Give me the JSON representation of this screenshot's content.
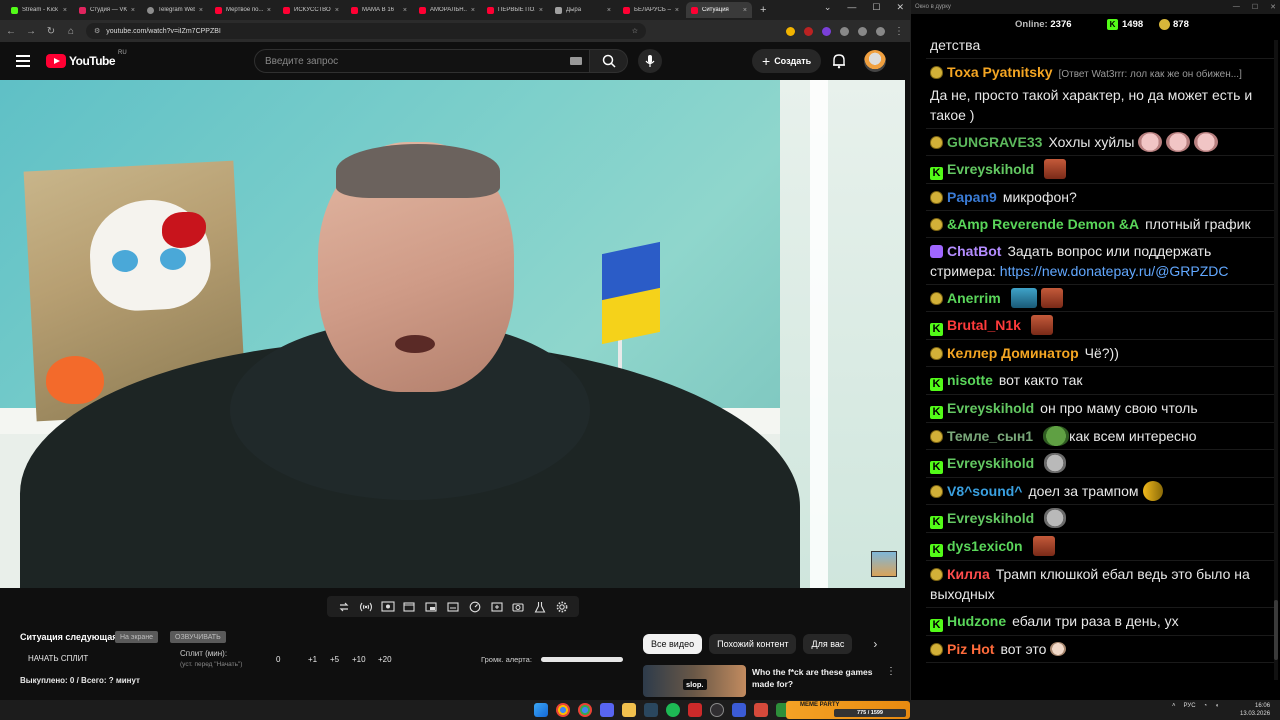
{
  "browser": {
    "tabs": [
      {
        "label": "Stream - Kick",
        "icon": "kick"
      },
      {
        "label": "Студия — VK",
        "icon": "vk"
      },
      {
        "label": "Telegram Web",
        "icon": "tg"
      },
      {
        "label": "Мертвое по...",
        "icon": "yt"
      },
      {
        "label": "ИСКУССТВО",
        "icon": "yt"
      },
      {
        "label": "МАМА В 16",
        "icon": "yt"
      },
      {
        "label": "АМОРАЛЬН...",
        "icon": "yt"
      },
      {
        "label": "ПЕРВЫЕ ПО...",
        "icon": "yt"
      },
      {
        "label": "Дыра",
        "icon": "dz"
      },
      {
        "label": "БЕЛАРУСЬ —",
        "icon": "yt"
      },
      {
        "label": "Ситуация",
        "icon": "yt",
        "active": true
      }
    ],
    "new_tab": "+",
    "window_controls": [
      "⌄",
      "—",
      "☐",
      "✕"
    ],
    "url": "youtube.com/watch?v=iIZm7CPPZBI"
  },
  "youtube": {
    "wordmark": "YouTube",
    "region": "RU",
    "search_placeholder": "Введите запрос",
    "create_label": "Создать"
  },
  "below": {
    "situation_title": "Ситуация следующая",
    "pill_onscreen": "На экране",
    "pill_voice": "ОЗВУЧИВАТЬ",
    "start_split": "НАЧАТЬ СПЛИТ",
    "split_label": "Сплит (мин):",
    "split_hint": "(уст. перед \"Начать\")",
    "split_values": [
      "0",
      "+1",
      "+5",
      "+10",
      "+20"
    ],
    "sold_out": "Выкуплено: 0 / Всего: ? минут",
    "alert_label": "Громк. алерта:",
    "alert_volume_fraction": 1.0,
    "chips": [
      "Все видео",
      "Похожий контент",
      "Для вас"
    ],
    "rec_badge": "slop.",
    "rec_title": "Who the f*ck are these games made for?"
  },
  "chat": {
    "window_title": "Окно в дурку",
    "online_label": "Online:",
    "online_count": "2376",
    "k_count": "1498",
    "pepe_count": "878",
    "messages": [
      {
        "badge": "",
        "nick": "",
        "color": "#e8e8e8",
        "text": "детства"
      },
      {
        "badge": "p",
        "nick": "Toxa Pyatnitsky",
        "color": "#f5a623",
        "reply": "[Ответ Wat3rrr: лол как же он обижен...]",
        "text": "Да не, просто такой характер, но да может есть и такое )"
      },
      {
        "badge": "p",
        "nick": "GUNGRAVE33",
        "color": "#5cb85c",
        "text": "Хохлы хуйлы",
        "emotes": [
          "brain",
          "brain",
          "brain"
        ]
      },
      {
        "badge": "k",
        "nick": "Evreyskihold",
        "color": "#63c862",
        "text": "",
        "emotes": [
          "face"
        ]
      },
      {
        "badge": "p",
        "nick": "Papan9",
        "color": "#3a7bd5",
        "text": "микрофон?"
      },
      {
        "badge": "p",
        "nick": "&Amp Reverende Demon &A",
        "color": "#5ad65a",
        "text": "плотный график"
      },
      {
        "badge": "bot",
        "nick": "ChatBot",
        "color": "#b48cff",
        "text": "Задать вопрос или поддержать стримера:",
        "link": "https://new.donatepay.ru/@GRPZDC"
      },
      {
        "badge": "p",
        "nick": "Anerrim",
        "color": "#5ad65a",
        "text": "",
        "emotes": [
          "blue",
          "face"
        ]
      },
      {
        "badge": "k",
        "nick": "Brutal_N1k",
        "color": "#ff3b3b",
        "text": "",
        "emotes": [
          "face"
        ]
      },
      {
        "badge": "p",
        "nick": "Келлер Доминатор",
        "color": "#f5a623",
        "text": "Чё?))"
      },
      {
        "badge": "k",
        "nick": "nisotte",
        "color": "#5ad65a",
        "text": "вот както так"
      },
      {
        "badge": "k",
        "nick": "Evreyskihold",
        "color": "#63c862",
        "text": "он про маму свою чтоль"
      },
      {
        "badge": "p",
        "nick": "Темле_сын1",
        "color": "#7aa87a",
        "text": "как всем интересно",
        "emotes_before": [
          "pepe"
        ]
      },
      {
        "badge": "k",
        "nick": "Evreyskihold",
        "color": "#63c862",
        "text": "",
        "emotes": [
          "cat"
        ]
      },
      {
        "badge": "p",
        "nick": "V8^sound^",
        "color": "#3aa0e0",
        "text": "доел за трампом",
        "emotes": [
          "fish"
        ]
      },
      {
        "badge": "k",
        "nick": "Evreyskihold",
        "color": "#63c862",
        "text": "",
        "emotes": [
          "cat"
        ]
      },
      {
        "badge": "k",
        "nick": "dys1exic0n",
        "color": "#5ad65a",
        "text": "",
        "emotes": [
          "face"
        ]
      },
      {
        "badge": "p",
        "nick": "Килла",
        "color": "#ff4d4d",
        "text": "Трамп клюшкой ебал ведь это было на выходных"
      },
      {
        "badge": "k",
        "nick": "Hudzone",
        "color": "#5ad65a",
        "text": "ебали три раза в день, ух"
      },
      {
        "badge": "p",
        "nick": "Piz Hot",
        "color": "#ff6b3b",
        "text": "вот это",
        "emotes": [
          "hand"
        ]
      }
    ]
  },
  "taskbar": {
    "meme_label": "MEME PARTY",
    "meme_count": "775 / 1599",
    "tray_lang": "РУС",
    "time": "16:06",
    "date": "13.03.2026"
  },
  "colors": {
    "yt_red": "#ff0033",
    "kick_green": "#53fc18",
    "link_blue": "#62a8ff"
  }
}
